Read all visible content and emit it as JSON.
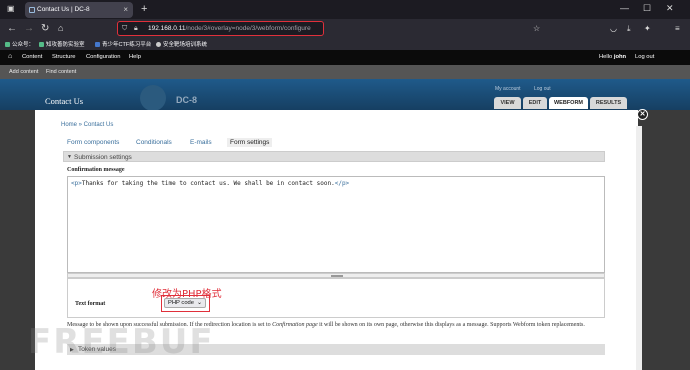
{
  "browser": {
    "tab_title": "Contact Us | DC-8",
    "tab_close": "×",
    "new_tab": "+",
    "minimize": "—",
    "maximize": "☐",
    "close": "✕",
    "url_host": "192.168.0.11",
    "url_path": "/node/3#overlay=node/3/webform/configure",
    "bookmarks": [
      "公众号：",
      "知攻善防实验室",
      "青少年CTF练习平台",
      "安全靶场培训系统"
    ]
  },
  "adminbar": {
    "items": [
      "Content",
      "Structure",
      "Configuration",
      "Help"
    ],
    "greeting": "Hello ",
    "user": "john",
    "logout": "Log out"
  },
  "shortcuts": [
    "Add content",
    "Find content"
  ],
  "header": {
    "site_title": "Contact Us",
    "logo": "DC-8",
    "user_links": [
      "My account",
      "Log out"
    ],
    "tabs": [
      "VIEW",
      "EDIT",
      "WEBFORM",
      "RESULTS"
    ],
    "active_tab": "WEBFORM"
  },
  "overlay": {
    "breadcrumb": "Home » Contact Us",
    "subtabs": [
      "Form components",
      "Conditionals",
      "E-mails",
      "Form settings"
    ],
    "active_subtab": "Form settings",
    "fieldset": "Submission settings",
    "confirmation_label": "Confirmation message",
    "confirmation_open": "<p>",
    "confirmation_text": "Thanks for taking the time to contact us. We shall be in contact soon.",
    "confirmation_close": "</p>",
    "text_format_label": "Text format",
    "text_format_value": "PHP code",
    "annotation": "修改为PHP格式",
    "description_pre": "Message to be shown upon successful submission. If the redirection location is set to ",
    "description_em": "Confirmation page",
    "description_post": " it will be shown on its own page, otherwise this displays as a message. Supports Webform token replacements.",
    "token_values": "Token values",
    "watermark": "FREEBUF"
  },
  "colors": {
    "highlight": "#e0303b",
    "link": "#3a6f9c",
    "header_blue": "#1c4f7a"
  }
}
